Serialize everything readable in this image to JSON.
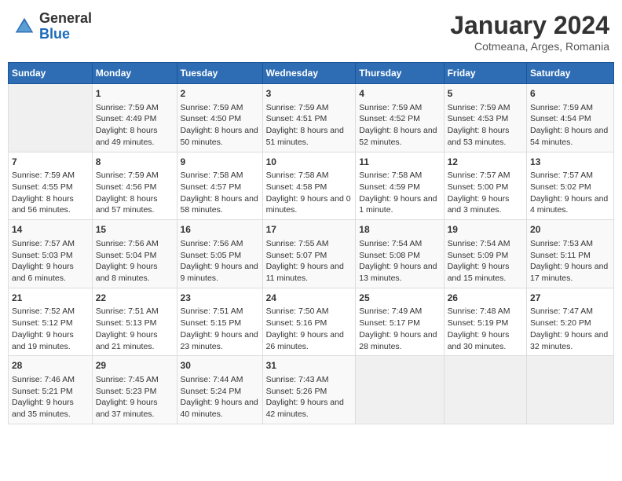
{
  "header": {
    "logo_general": "General",
    "logo_blue": "Blue",
    "month_title": "January 2024",
    "subtitle": "Cotmeana, Arges, Romania"
  },
  "days_of_week": [
    "Sunday",
    "Monday",
    "Tuesday",
    "Wednesday",
    "Thursday",
    "Friday",
    "Saturday"
  ],
  "weeks": [
    [
      {
        "day": "",
        "sunrise": "",
        "sunset": "",
        "daylight": ""
      },
      {
        "day": "1",
        "sunrise": "Sunrise: 7:59 AM",
        "sunset": "Sunset: 4:49 PM",
        "daylight": "Daylight: 8 hours and 49 minutes."
      },
      {
        "day": "2",
        "sunrise": "Sunrise: 7:59 AM",
        "sunset": "Sunset: 4:50 PM",
        "daylight": "Daylight: 8 hours and 50 minutes."
      },
      {
        "day": "3",
        "sunrise": "Sunrise: 7:59 AM",
        "sunset": "Sunset: 4:51 PM",
        "daylight": "Daylight: 8 hours and 51 minutes."
      },
      {
        "day": "4",
        "sunrise": "Sunrise: 7:59 AM",
        "sunset": "Sunset: 4:52 PM",
        "daylight": "Daylight: 8 hours and 52 minutes."
      },
      {
        "day": "5",
        "sunrise": "Sunrise: 7:59 AM",
        "sunset": "Sunset: 4:53 PM",
        "daylight": "Daylight: 8 hours and 53 minutes."
      },
      {
        "day": "6",
        "sunrise": "Sunrise: 7:59 AM",
        "sunset": "Sunset: 4:54 PM",
        "daylight": "Daylight: 8 hours and 54 minutes."
      }
    ],
    [
      {
        "day": "7",
        "sunrise": "Sunrise: 7:59 AM",
        "sunset": "Sunset: 4:55 PM",
        "daylight": "Daylight: 8 hours and 56 minutes."
      },
      {
        "day": "8",
        "sunrise": "Sunrise: 7:59 AM",
        "sunset": "Sunset: 4:56 PM",
        "daylight": "Daylight: 8 hours and 57 minutes."
      },
      {
        "day": "9",
        "sunrise": "Sunrise: 7:58 AM",
        "sunset": "Sunset: 4:57 PM",
        "daylight": "Daylight: 8 hours and 58 minutes."
      },
      {
        "day": "10",
        "sunrise": "Sunrise: 7:58 AM",
        "sunset": "Sunset: 4:58 PM",
        "daylight": "Daylight: 9 hours and 0 minutes."
      },
      {
        "day": "11",
        "sunrise": "Sunrise: 7:58 AM",
        "sunset": "Sunset: 4:59 PM",
        "daylight": "Daylight: 9 hours and 1 minute."
      },
      {
        "day": "12",
        "sunrise": "Sunrise: 7:57 AM",
        "sunset": "Sunset: 5:00 PM",
        "daylight": "Daylight: 9 hours and 3 minutes."
      },
      {
        "day": "13",
        "sunrise": "Sunrise: 7:57 AM",
        "sunset": "Sunset: 5:02 PM",
        "daylight": "Daylight: 9 hours and 4 minutes."
      }
    ],
    [
      {
        "day": "14",
        "sunrise": "Sunrise: 7:57 AM",
        "sunset": "Sunset: 5:03 PM",
        "daylight": "Daylight: 9 hours and 6 minutes."
      },
      {
        "day": "15",
        "sunrise": "Sunrise: 7:56 AM",
        "sunset": "Sunset: 5:04 PM",
        "daylight": "Daylight: 9 hours and 8 minutes."
      },
      {
        "day": "16",
        "sunrise": "Sunrise: 7:56 AM",
        "sunset": "Sunset: 5:05 PM",
        "daylight": "Daylight: 9 hours and 9 minutes."
      },
      {
        "day": "17",
        "sunrise": "Sunrise: 7:55 AM",
        "sunset": "Sunset: 5:07 PM",
        "daylight": "Daylight: 9 hours and 11 minutes."
      },
      {
        "day": "18",
        "sunrise": "Sunrise: 7:54 AM",
        "sunset": "Sunset: 5:08 PM",
        "daylight": "Daylight: 9 hours and 13 minutes."
      },
      {
        "day": "19",
        "sunrise": "Sunrise: 7:54 AM",
        "sunset": "Sunset: 5:09 PM",
        "daylight": "Daylight: 9 hours and 15 minutes."
      },
      {
        "day": "20",
        "sunrise": "Sunrise: 7:53 AM",
        "sunset": "Sunset: 5:11 PM",
        "daylight": "Daylight: 9 hours and 17 minutes."
      }
    ],
    [
      {
        "day": "21",
        "sunrise": "Sunrise: 7:52 AM",
        "sunset": "Sunset: 5:12 PM",
        "daylight": "Daylight: 9 hours and 19 minutes."
      },
      {
        "day": "22",
        "sunrise": "Sunrise: 7:51 AM",
        "sunset": "Sunset: 5:13 PM",
        "daylight": "Daylight: 9 hours and 21 minutes."
      },
      {
        "day": "23",
        "sunrise": "Sunrise: 7:51 AM",
        "sunset": "Sunset: 5:15 PM",
        "daylight": "Daylight: 9 hours and 23 minutes."
      },
      {
        "day": "24",
        "sunrise": "Sunrise: 7:50 AM",
        "sunset": "Sunset: 5:16 PM",
        "daylight": "Daylight: 9 hours and 26 minutes."
      },
      {
        "day": "25",
        "sunrise": "Sunrise: 7:49 AM",
        "sunset": "Sunset: 5:17 PM",
        "daylight": "Daylight: 9 hours and 28 minutes."
      },
      {
        "day": "26",
        "sunrise": "Sunrise: 7:48 AM",
        "sunset": "Sunset: 5:19 PM",
        "daylight": "Daylight: 9 hours and 30 minutes."
      },
      {
        "day": "27",
        "sunrise": "Sunrise: 7:47 AM",
        "sunset": "Sunset: 5:20 PM",
        "daylight": "Daylight: 9 hours and 32 minutes."
      }
    ],
    [
      {
        "day": "28",
        "sunrise": "Sunrise: 7:46 AM",
        "sunset": "Sunset: 5:21 PM",
        "daylight": "Daylight: 9 hours and 35 minutes."
      },
      {
        "day": "29",
        "sunrise": "Sunrise: 7:45 AM",
        "sunset": "Sunset: 5:23 PM",
        "daylight": "Daylight: 9 hours and 37 minutes."
      },
      {
        "day": "30",
        "sunrise": "Sunrise: 7:44 AM",
        "sunset": "Sunset: 5:24 PM",
        "daylight": "Daylight: 9 hours and 40 minutes."
      },
      {
        "day": "31",
        "sunrise": "Sunrise: 7:43 AM",
        "sunset": "Sunset: 5:26 PM",
        "daylight": "Daylight: 9 hours and 42 minutes."
      },
      {
        "day": "",
        "sunrise": "",
        "sunset": "",
        "daylight": ""
      },
      {
        "day": "",
        "sunrise": "",
        "sunset": "",
        "daylight": ""
      },
      {
        "day": "",
        "sunrise": "",
        "sunset": "",
        "daylight": ""
      }
    ]
  ]
}
